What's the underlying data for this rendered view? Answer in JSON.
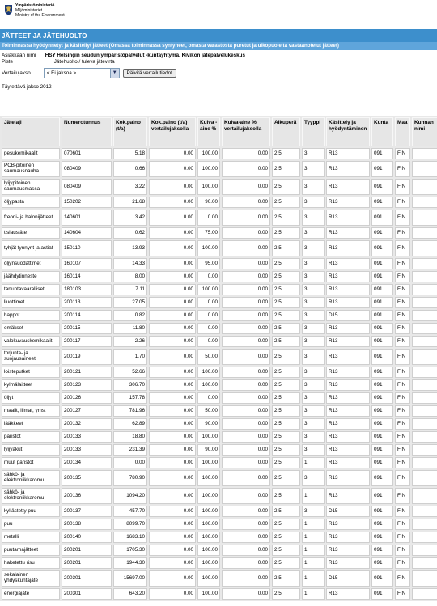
{
  "header": {
    "logo_lines": [
      "Ympäristöministeriö",
      "Miljöministeriet",
      "Ministry of the Environment"
    ],
    "title": "JÄTTEET JA JÄTEHUOLTO",
    "subtitle": "Toiminnassa hyödynnetyt ja käsitellyt jätteet (Omassa toiminnassa syntyneet, omasta varastosta puretut ja ulkopuolelta vastaanotetut jätteet)"
  },
  "info": {
    "asiakas_label": "Asiakkaan nimi",
    "asiakas_value": "HSY Helsingin seudun ympäristöpalvelut -kuntayhtymä, Kivikon jätepalvelukeskus",
    "piste_label": "Piste",
    "piste_value": "Jätehuolto / tuleva jätevirta",
    "vertailu_label": "Vertailujakso",
    "vertailu_selected": "< Ei jaksoa >",
    "update_button": "Päivitä vertailutiedot",
    "tayttava_label": "Täytettävä jakso",
    "tayttava_value": "2012"
  },
  "table": {
    "headers": [
      "Jätelaji",
      "Numerotunnus",
      "Kok.paino (t/a)",
      "Kok.paino (t/a) vertailujaksolla",
      "Kuiva -aine %",
      "Kuiva-aine % vertailujaksolla",
      "Alkuperä",
      "Tyyppi",
      "Käsittely ja hyödyntäminen",
      "Kunta",
      "Maa",
      "Kunnan nimi"
    ],
    "rows": [
      [
        "pesukemikaalit",
        "070601",
        "5.18",
        "0.00",
        "100.00",
        "0.00",
        "2.5",
        "3",
        "R13",
        "091",
        "FIN",
        ""
      ],
      [
        "PCB-pitoinen saumausnauha",
        "080409",
        "0.66",
        "0.00",
        "100.00",
        "0.00",
        "2.5",
        "3",
        "R13",
        "091",
        "FIN",
        ""
      ],
      [
        "lyijypitoinen saumausmassa",
        "080409",
        "3.22",
        "0.00",
        "100.00",
        "0.00",
        "2.5",
        "3",
        "R13",
        "091",
        "FIN",
        ""
      ],
      [
        "öljypasta",
        "150202",
        "21.68",
        "0.00",
        "90.00",
        "0.00",
        "2.5",
        "3",
        "R13",
        "091",
        "FIN",
        ""
      ],
      [
        "freoni- ja halonijätteet",
        "140601",
        "3.42",
        "0.00",
        "0.00",
        "0.00",
        "2.5",
        "3",
        "R13",
        "091",
        "FIN",
        ""
      ],
      [
        "tislausjäte",
        "140604",
        "0.62",
        "0.00",
        "75.00",
        "0.00",
        "2.5",
        "3",
        "R13",
        "091",
        "FIN",
        ""
      ],
      [
        "tyhjät tynnyrit ja astiat",
        "150110",
        "13.93",
        "0.00",
        "100.00",
        "0.00",
        "2.5",
        "3",
        "R13",
        "091",
        "FIN",
        ""
      ],
      [
        "öljynsuodattimet",
        "160107",
        "14.33",
        "0.00",
        "95.00",
        "0.00",
        "2.5",
        "3",
        "R13",
        "091",
        "FIN",
        ""
      ],
      [
        "jäähdytinneste",
        "160114",
        "8.00",
        "0.00",
        "0.00",
        "0.00",
        "2.5",
        "3",
        "R13",
        "091",
        "FIN",
        ""
      ],
      [
        "tartuntavaaralliset",
        "180103",
        "7.11",
        "0.00",
        "100.00",
        "0.00",
        "2.5",
        "3",
        "R13",
        "091",
        "FIN",
        ""
      ],
      [
        "liuottimet",
        "200113",
        "27.05",
        "0.00",
        "0.00",
        "0.00",
        "2.5",
        "3",
        "R13",
        "091",
        "FIN",
        ""
      ],
      [
        "happot",
        "200114",
        "0.82",
        "0.00",
        "0.00",
        "0.00",
        "2.5",
        "3",
        "D15",
        "091",
        "FIN",
        ""
      ],
      [
        "emäkset",
        "200115",
        "11.80",
        "0.00",
        "0.00",
        "0.00",
        "2.5",
        "3",
        "R13",
        "091",
        "FIN",
        ""
      ],
      [
        "valokuvauskemikaalit",
        "200117",
        "2.26",
        "0.00",
        "0.00",
        "0.00",
        "2.5",
        "3",
        "R13",
        "091",
        "FIN",
        ""
      ],
      [
        "torjunta- ja suojausaineet",
        "200119",
        "1.70",
        "0.00",
        "50.00",
        "0.00",
        "2.5",
        "3",
        "R13",
        "091",
        "FIN",
        ""
      ],
      [
        "loisteputket",
        "200121",
        "52.66",
        "0.00",
        "100.00",
        "0.00",
        "2.5",
        "3",
        "R13",
        "091",
        "FIN",
        ""
      ],
      [
        "kylmälaitteet",
        "200123",
        "306.70",
        "0.00",
        "100.00",
        "0.00",
        "2.5",
        "3",
        "R13",
        "091",
        "FIN",
        ""
      ],
      [
        "öljyt",
        "200126",
        "157.78",
        "0.00",
        "0.00",
        "0.00",
        "2.5",
        "3",
        "R13",
        "091",
        "FIN",
        ""
      ],
      [
        "maalit, liimat, yms.",
        "200127",
        "781.96",
        "0.00",
        "50.00",
        "0.00",
        "2.5",
        "3",
        "R13",
        "091",
        "FIN",
        ""
      ],
      [
        "lääkkeet",
        "200132",
        "62.89",
        "0.00",
        "90.00",
        "0.00",
        "2.5",
        "3",
        "R13",
        "091",
        "FIN",
        ""
      ],
      [
        "paristot",
        "200133",
        "18.80",
        "0.00",
        "100.00",
        "0.00",
        "2.5",
        "3",
        "R13",
        "091",
        "FIN",
        ""
      ],
      [
        "lyijyakut",
        "200133",
        "231.39",
        "0.00",
        "90.00",
        "0.00",
        "2.5",
        "3",
        "R13",
        "091",
        "FIN",
        ""
      ],
      [
        "muut paristot",
        "200134",
        "0.00",
        "0.00",
        "100.00",
        "0.00",
        "2.5",
        "1",
        "R13",
        "091",
        "FIN",
        ""
      ],
      [
        "sähkö- ja elektroniikkaromu",
        "200135",
        "780.90",
        "0.00",
        "100.00",
        "0.00",
        "2.5",
        "3",
        "R13",
        "091",
        "FIN",
        ""
      ],
      [
        "sähkö- ja elektroniikkaromu",
        "200136",
        "1094.20",
        "0.00",
        "100.00",
        "0.00",
        "2.5",
        "1",
        "R13",
        "091",
        "FIN",
        ""
      ],
      [
        "kyllästetty puu",
        "200137",
        "457.70",
        "0.00",
        "100.00",
        "0.00",
        "2.5",
        "3",
        "D15",
        "091",
        "FIN",
        ""
      ],
      [
        "puu",
        "200138",
        "8099.70",
        "0.00",
        "100.00",
        "0.00",
        "2.5",
        "1",
        "R13",
        "091",
        "FIN",
        ""
      ],
      [
        "metalli",
        "200140",
        "1683.10",
        "0.00",
        "100.00",
        "0.00",
        "2.5",
        "1",
        "R13",
        "091",
        "FIN",
        ""
      ],
      [
        "puutarhajätteet",
        "200201",
        "1705.30",
        "0.00",
        "100.00",
        "0.00",
        "2.5",
        "1",
        "R13",
        "091",
        "FIN",
        ""
      ],
      [
        "haketettu risu",
        "200201",
        "1944.30",
        "0.00",
        "100.00",
        "0.00",
        "2.5",
        "1",
        "R13",
        "091",
        "FIN",
        ""
      ],
      [
        "sekalainen yhdyskuntajäte",
        "200301",
        "15697.00",
        "0.00",
        "100.00",
        "0.00",
        "2.5",
        "1",
        "D15",
        "091",
        "FIN",
        ""
      ],
      [
        "energiajäte",
        "200301",
        "643.20",
        "0.00",
        "100.00",
        "0.00",
        "2.5",
        "1",
        "R13",
        "091",
        "FIN",
        ""
      ]
    ]
  }
}
